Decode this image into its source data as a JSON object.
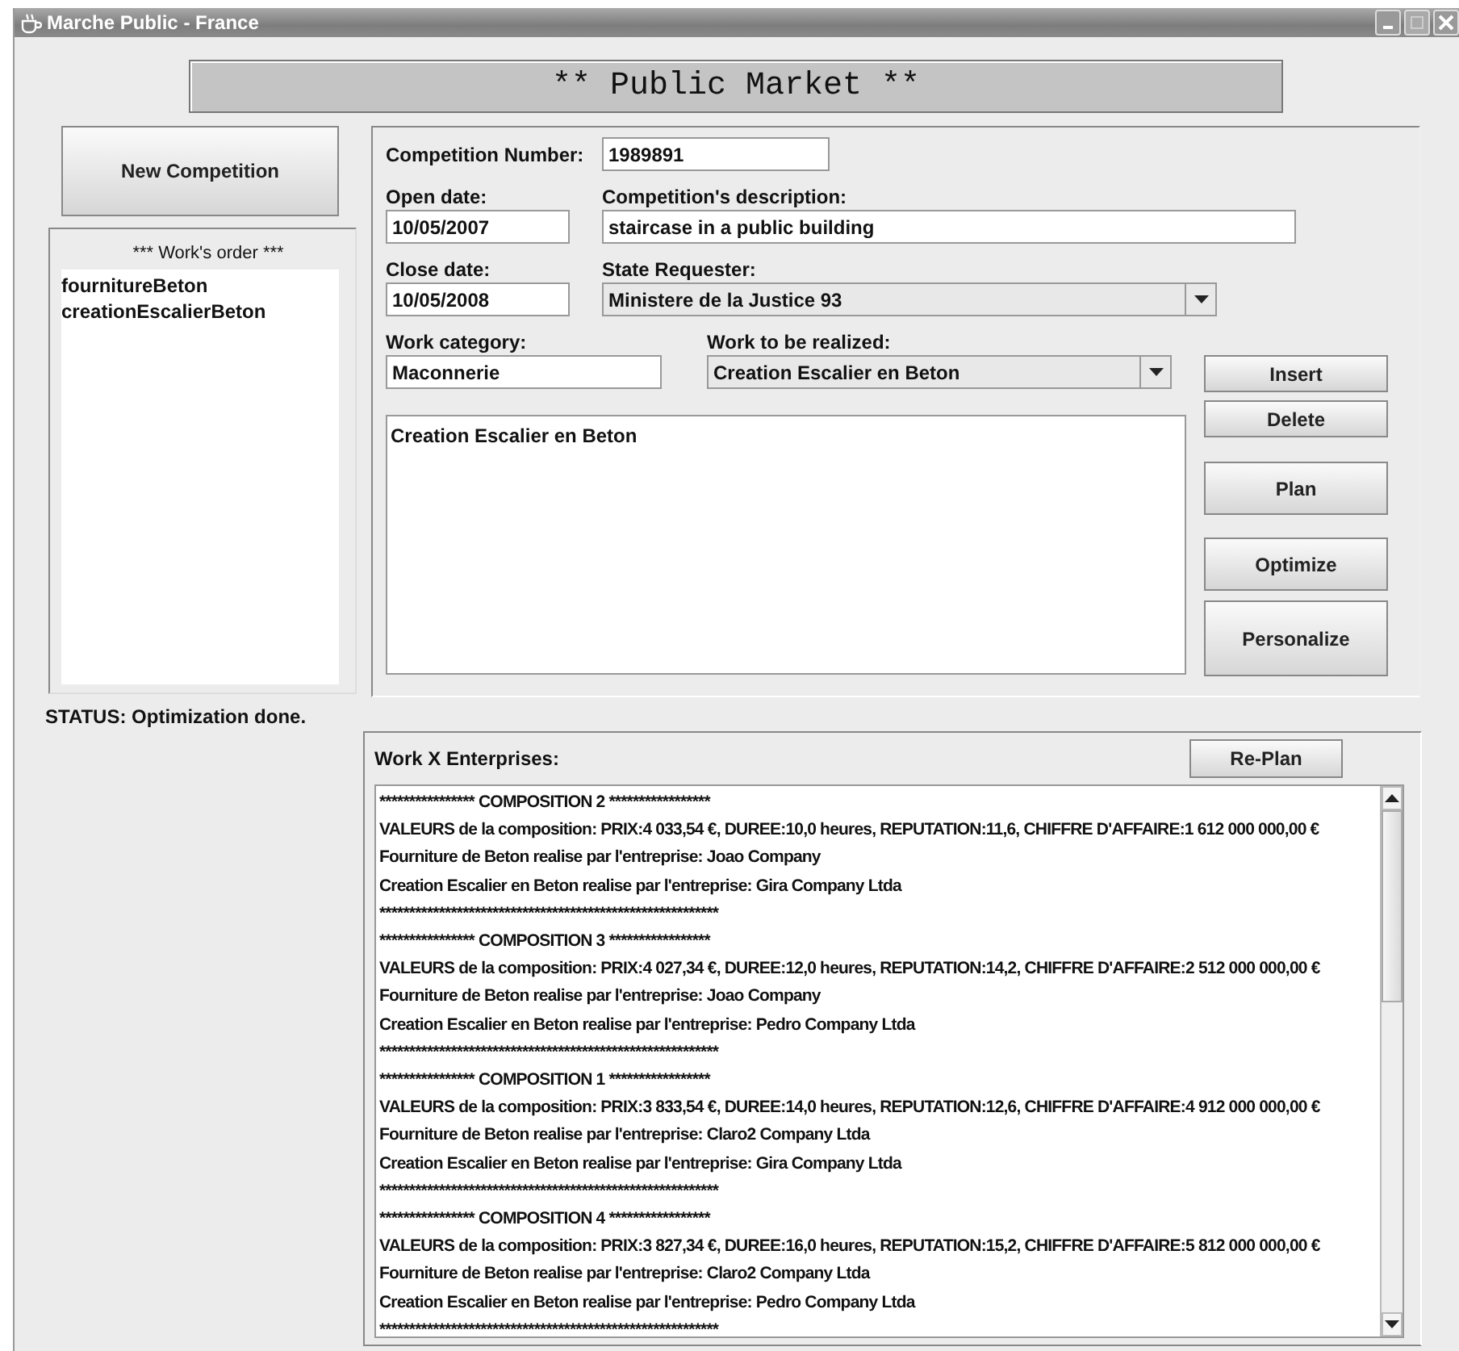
{
  "window": {
    "title": "Marche Public - France"
  },
  "header": "** Public Market **",
  "new_competition_button": "New Competition",
  "works_order": {
    "title": "*** Work's order ***",
    "items": [
      "fournitureBeton",
      "creationEscalierBeton"
    ]
  },
  "form": {
    "competition_number": {
      "label": "Competition Number:",
      "value": "1989891"
    },
    "open_date": {
      "label": "Open date:",
      "value": "10/05/2007"
    },
    "description": {
      "label": "Competition's description:",
      "value": "staircase in a public building"
    },
    "close_date": {
      "label": "Close date:",
      "value": "10/05/2008"
    },
    "state_requester": {
      "label": "State Requester:",
      "value": "Ministere de la Justice 93"
    },
    "work_category": {
      "label": "Work category:",
      "value": "Maconnerie"
    },
    "work_to_realize": {
      "label": "Work to be realized:",
      "value": "Creation Escalier en Beton"
    },
    "notes": "Creation Escalier en Beton"
  },
  "buttons": [
    "Insert",
    "Delete",
    "Plan",
    "Optimize",
    "Personalize"
  ],
  "status": "STATUS: Optimization done.",
  "results": {
    "title": "Work X Enterprises:",
    "replan_button": "Re-Plan",
    "lines": [
      "**************** COMPOSITION 2 *****************",
      "VALEURS de la composition: PRIX:4 033,54 €, DUREE:10,0 heures, REPUTATION:11,6, CHIFFRE D'AFFAIRE:1 612 000 000,00 €",
      "Fourniture de Beton realise par l'entreprise: Joao Company",
      "Creation Escalier en Beton realise par l'entreprise: Gira Company Ltda",
      "*********************************************************",
      "**************** COMPOSITION 3 *****************",
      "VALEURS de la composition: PRIX:4 027,34 €, DUREE:12,0 heures, REPUTATION:14,2, CHIFFRE D'AFFAIRE:2 512 000 000,00 €",
      "Fourniture de Beton realise par l'entreprise: Joao Company",
      "Creation Escalier en Beton realise par l'entreprise: Pedro Company Ltda",
      "*********************************************************",
      "**************** COMPOSITION 1 *****************",
      "VALEURS de la composition: PRIX:3 833,54 €, DUREE:14,0 heures, REPUTATION:12,6, CHIFFRE D'AFFAIRE:4 912 000 000,00 €",
      "Fourniture de Beton realise par l'entreprise: Claro2 Company Ltda",
      "Creation Escalier en Beton realise par l'entreprise: Gira Company Ltda",
      "*********************************************************",
      "**************** COMPOSITION 4 *****************",
      "VALEURS de la composition: PRIX:3 827,34 €, DUREE:16,0 heures, REPUTATION:15,2, CHIFFRE D'AFFAIRE:5 812 000 000,00 €",
      "Fourniture de Beton realise par l'entreprise: Claro2 Company Ltda",
      "Creation Escalier en Beton realise par l'entreprise: Pedro Company Ltda",
      "*********************************************************"
    ]
  }
}
